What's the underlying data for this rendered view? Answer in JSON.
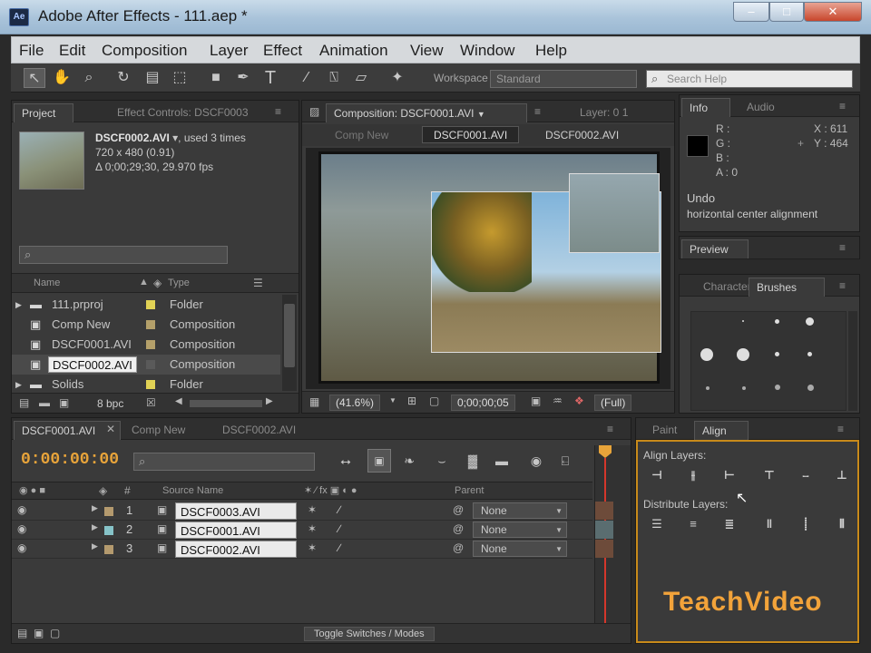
{
  "window": {
    "title": "Adobe After Effects - 111.aep *",
    "app_icon": "Ae",
    "minimize": "‒",
    "maximize": "□",
    "close": "✕"
  },
  "menu": [
    "File",
    "Edit",
    "Composition",
    "Layer",
    "Effect",
    "Animation",
    "View",
    "Window",
    "Help"
  ],
  "toolbar": {
    "workspace_label": "Workspace",
    "workspace_value": "Standard",
    "search_placeholder": "Search Help"
  },
  "project": {
    "tabs": [
      "Project",
      "Effect Controls: DSCF0003"
    ],
    "footage_name": "DSCF0002.AVI",
    "footage_used": ", used 3 times",
    "footage_dims": "720 x 480 (0.91)",
    "footage_duration": "Δ 0;00;29;30, 29.970 fps",
    "search_placeholder": "",
    "col_name": "Name",
    "col_type": "Type",
    "items": [
      {
        "name": "111.prproj",
        "type": "Folder",
        "color": "#e1d255"
      },
      {
        "name": "Comp New",
        "type": "Composition",
        "color": "#b4a06a"
      },
      {
        "name": "DSCF0001.AVI",
        "type": "Composition",
        "color": "#b4a06a"
      },
      {
        "name": "DSCF0002.AVI",
        "type": "Composition",
        "color": "#5a5a5a"
      },
      {
        "name": "Solids",
        "type": "Folder",
        "color": "#e1d255"
      }
    ],
    "bpc": "8 bpc"
  },
  "composition": {
    "panel_title": "Composition: DSCF0001.AVI",
    "layer_tab": "Layer: 0 1",
    "breadcrumb_left": "Comp New",
    "breadcrumb_active": "DSCF0001.AVI",
    "breadcrumb_right": "DSCF0002.AVI",
    "zoom": "(41.6%)",
    "timecode": "0;00;00;05",
    "resolution": "(Full)"
  },
  "info": {
    "tabs": [
      "Info",
      "Audio"
    ],
    "r": "R :",
    "g": "G :",
    "b": "B :",
    "a": "A : 0",
    "x": "X : 611",
    "y": "Y : 464",
    "undo_label": "Undo",
    "undo_action": "horizontal center alignment"
  },
  "preview": {
    "tab": "Preview"
  },
  "brushes": {
    "tabs": [
      "Character",
      "Brushes"
    ]
  },
  "timeline": {
    "tabs": [
      "DSCF0001.AVI",
      "Comp New",
      "DSCF0002.AVI"
    ],
    "timecode": "0:00:00:00",
    "col_source": "Source Name",
    "col_parent": "Parent",
    "layers": [
      {
        "num": "1",
        "name": "DSCF0003.AVI",
        "color": "#b49a6e",
        "parent": "None"
      },
      {
        "num": "2",
        "name": "DSCF0001.AVI",
        "color": "#86c3c8",
        "parent": "None"
      },
      {
        "num": "3",
        "name": "DSCF0002.AVI",
        "color": "#b49a6e",
        "parent": "None"
      }
    ],
    "toggle_label": "Toggle Switches / Modes"
  },
  "align": {
    "tabs": [
      "Paint",
      "Align"
    ],
    "align_label": "Align Layers:",
    "distribute_label": "Distribute Layers:"
  },
  "watermark": "TeachVideo",
  "colors": {
    "accent_orange": "#e8a43a",
    "selection_border": "#c88a1a",
    "watermark_orange": "#f2a33a",
    "watermark_blue": "#4a88d6"
  }
}
